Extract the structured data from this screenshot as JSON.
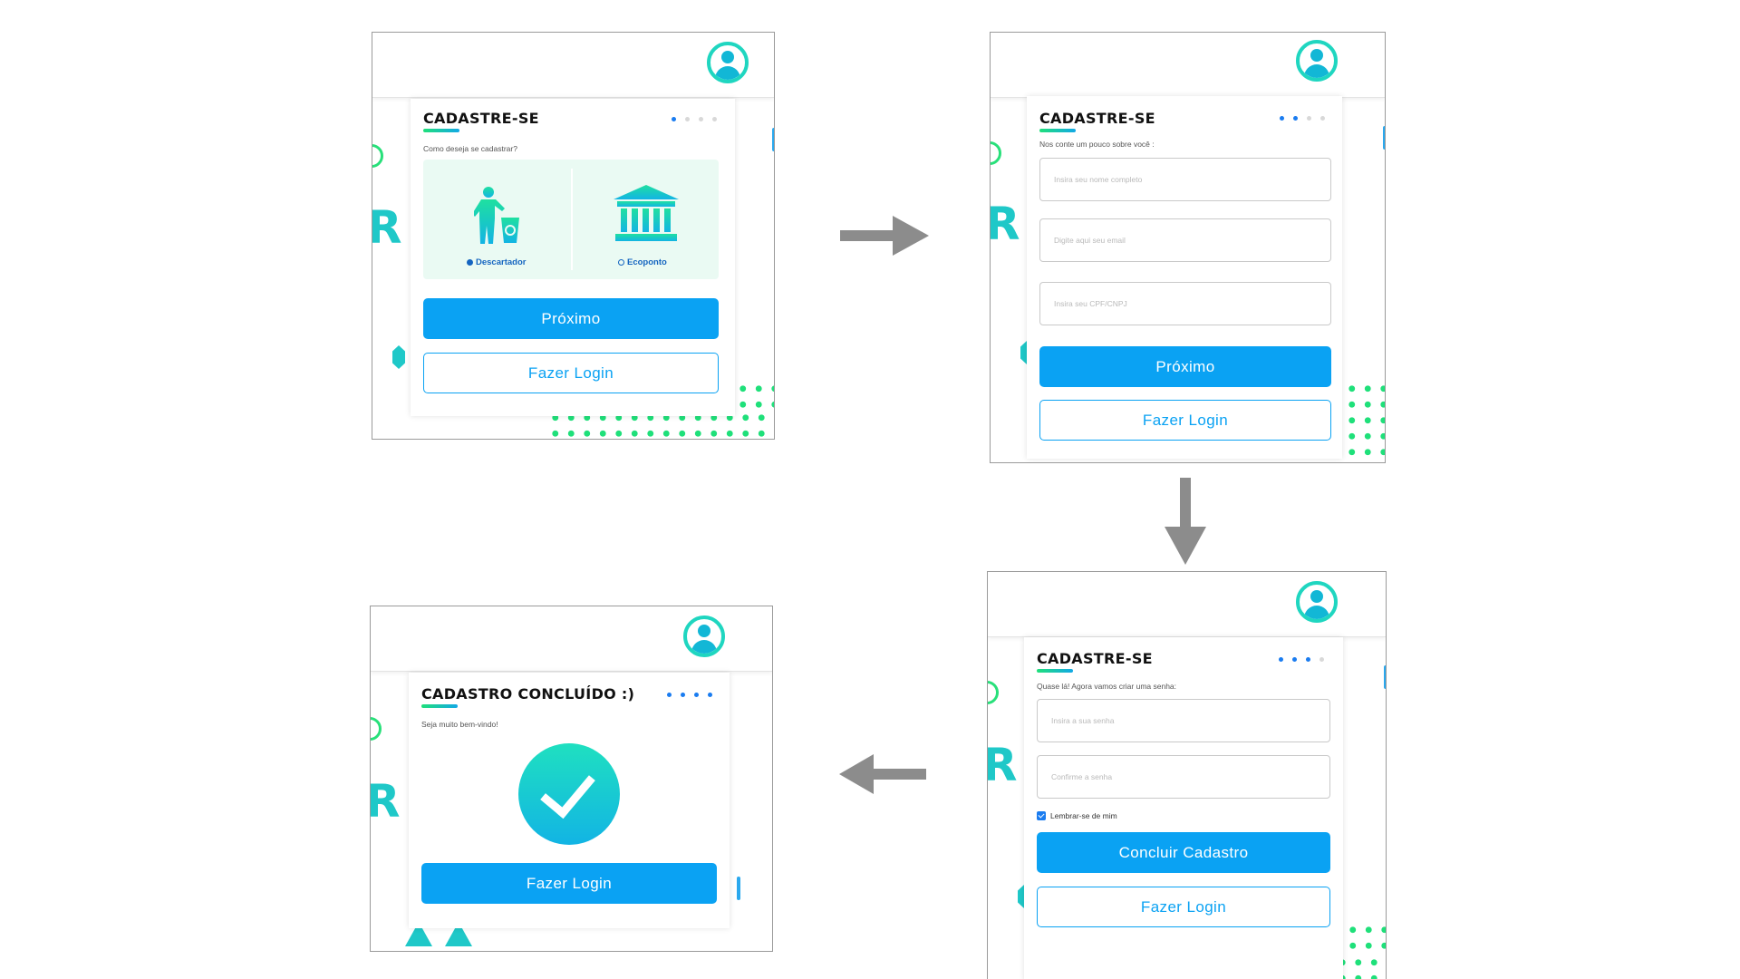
{
  "screen1": {
    "title": "CADASTRE-SE",
    "subtitle": "Como deseja se cadastrar?",
    "steps_active": 1,
    "options": [
      {
        "label": "Descartador",
        "icon": "person-trash-icon",
        "selected": true
      },
      {
        "label": "Ecoponto",
        "icon": "bank-building-icon",
        "selected": false
      }
    ],
    "next_label": "Próximo",
    "login_label": "Fazer Login"
  },
  "screen2": {
    "title": "CADASTRE-SE",
    "subtitle": "Nos conte um pouco sobre você :",
    "steps_active": 2,
    "name_placeholder": "Insira seu nome completo",
    "email_placeholder": "Digite aqui seu email",
    "doc_placeholder": "Insira seu CPF/CNPJ",
    "next_label": "Próximo",
    "login_label": "Fazer Login"
  },
  "screen3": {
    "title": "CADASTRE-SE",
    "subtitle": "Quase lá! Agora vamos criar uma senha:",
    "steps_active": 3,
    "password_placeholder": "Insira a sua senha",
    "confirm_placeholder": "Confirme a senha",
    "remember_label": "Lembrar-se de mim",
    "remember_checked": true,
    "finish_label": "Concluir Cadastro",
    "login_label": "Fazer Login"
  },
  "screen4": {
    "title": "CADASTRO CONCLUÍDO :)",
    "subtitle": "Seja muito bem-vindo!",
    "steps_active": 4,
    "login_label": "Fazer Login"
  },
  "colors": {
    "primary": "#0aa2f3",
    "accent_green": "#1fe07a",
    "accent_teal": "#1fc8c8",
    "step_active": "#1a7cf0",
    "arrow": "#8c8c8c"
  }
}
